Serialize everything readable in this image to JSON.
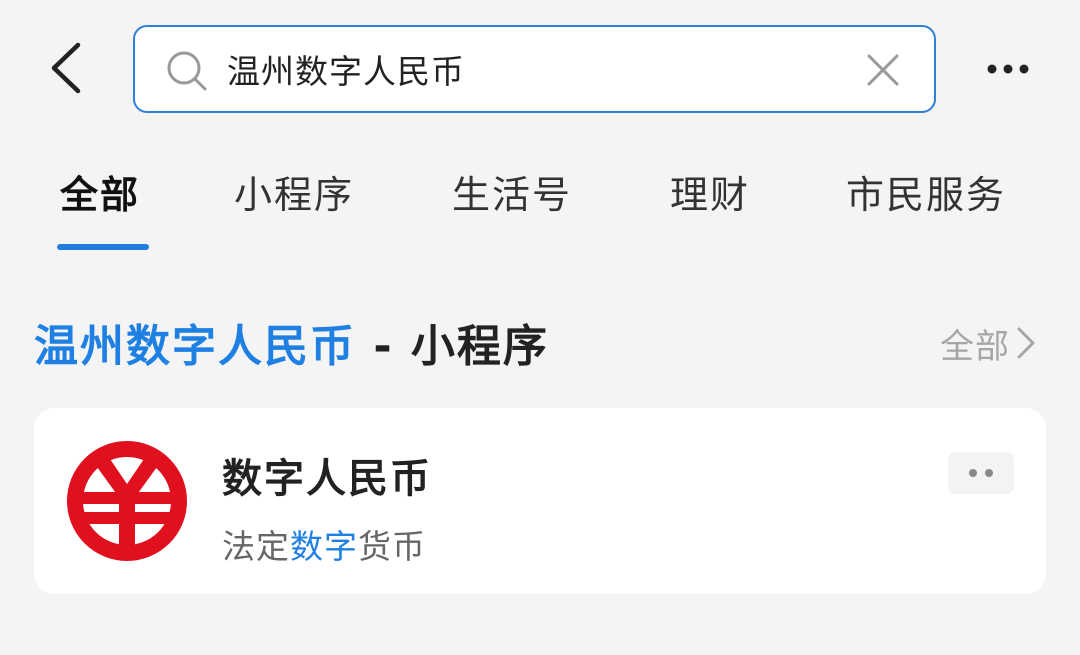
{
  "search": {
    "value": "温州数字人民币"
  },
  "tabs": [
    {
      "label": "全部",
      "active": true
    },
    {
      "label": "小程序",
      "active": false
    },
    {
      "label": "生活号",
      "active": false
    },
    {
      "label": "理财",
      "active": false
    },
    {
      "label": "市民服务",
      "active": false
    }
  ],
  "section": {
    "title_highlight": "温州数字人民币",
    "title_rest": " - 小程序",
    "more_label": "全部"
  },
  "result": {
    "name": "数字人民币",
    "desc_prefix": "法定",
    "desc_highlight": "数字",
    "desc_suffix": "货币",
    "logo_icon": "digital-rmb-logo-icon"
  },
  "colors": {
    "accent": "#1f80e3",
    "search_border": "#2f7fd6",
    "logo_red": "#e0101e",
    "background": "#f4f4f4"
  },
  "icons": {
    "back": "chevron-left-icon",
    "search": "search-icon",
    "clear": "close-icon",
    "more": "more-horizontal-icon",
    "section_more": "chevron-right-icon"
  }
}
